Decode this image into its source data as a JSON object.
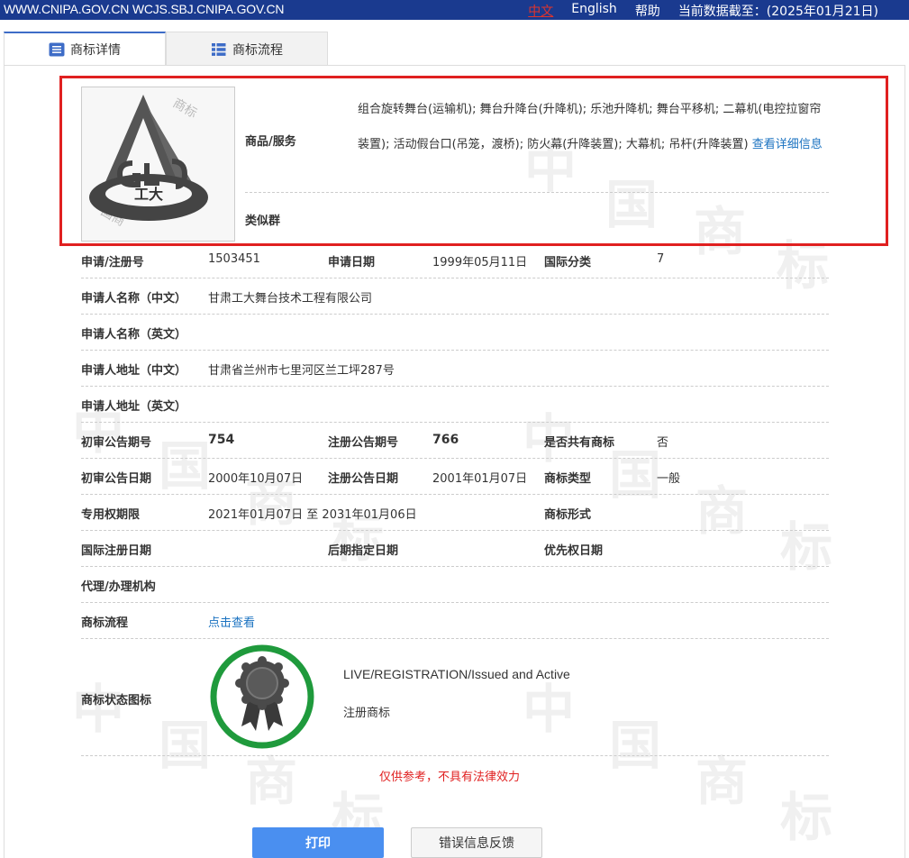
{
  "topbar": {
    "site": "WWW.CNIPA.GOV.CN WCJS.SBJ.CNIPA.GOV.CN",
    "lang_zh": "中文",
    "lang_en": "English",
    "help": "帮助",
    "data_as_of": "当前数据截至：(2025年01月21日)"
  },
  "tabs": [
    {
      "label": "商标详情",
      "active": true,
      "icon": "list-icon"
    },
    {
      "label": "商标流程",
      "active": false,
      "icon": "grid-list-icon"
    }
  ],
  "goods": {
    "label": "商品/服务",
    "text": "组合旋转舞台(运输机); 舞台升降台(升降机); 乐池升降机; 舞台平移机; 二幕机(电控拉窗帘装置); 活动假台口(吊笼，渡桥); 防火幕(升降装置); 大幕机; 吊杆(升降装置)",
    "more_link": "查看详细信息"
  },
  "similar_group": {
    "label": "类似群",
    "value": ""
  },
  "details": {
    "reg_no_label": "申请/注册号",
    "reg_no": "1503451",
    "app_date_label": "申请日期",
    "app_date": "1999年05月11日",
    "intl_class_label": "国际分类",
    "intl_class": "7",
    "applicant_cn_label": "申请人名称（中文）",
    "applicant_cn": "甘肃工大舞台技术工程有限公司",
    "applicant_en_label": "申请人名称（英文）",
    "applicant_en": "",
    "address_cn_label": "申请人地址（中文）",
    "address_cn": "甘肃省兰州市七里河区兰工坪287号",
    "address_en_label": "申请人地址（英文）",
    "address_en": "",
    "prelim_issue_label": "初审公告期号",
    "prelim_issue": "754",
    "reg_issue_label": "注册公告期号",
    "reg_issue": "766",
    "shared_label": "是否共有商标",
    "shared": "否",
    "prelim_date_label": "初审公告日期",
    "prelim_date": "2000年10月07日",
    "reg_date_label": "注册公告日期",
    "reg_date": "2001年01月07日",
    "tm_type_label": "商标类型",
    "tm_type": "一般",
    "term_label": "专用权期限",
    "term": "2021年01月07日 至 2031年01月06日",
    "tm_form_label": "商标形式",
    "tm_form": "",
    "intl_reg_date_label": "国际注册日期",
    "intl_reg_date": "",
    "later_date_label": "后期指定日期",
    "later_date": "",
    "priority_date_label": "优先权日期",
    "priority_date": "",
    "agent_label": "代理/办理机构",
    "agent": "",
    "flow_label": "商标流程",
    "flow_link": "点击查看",
    "status_icon_label": "商标状态图标"
  },
  "status": {
    "en": "LIVE/REGISTRATION/Issued and Active",
    "zh": "注册商标",
    "ring_color": "#1f9a3c"
  },
  "disclaimer": "仅供参考，不具有法律效力",
  "buttons": {
    "print": "打印",
    "feedback": "错误信息反馈"
  },
  "logo_text": "工大",
  "colors": {
    "topbar": "#1a3a8f",
    "link": "#1a72c0",
    "alert": "#e02020",
    "primary_button": "#4a8ff0"
  }
}
